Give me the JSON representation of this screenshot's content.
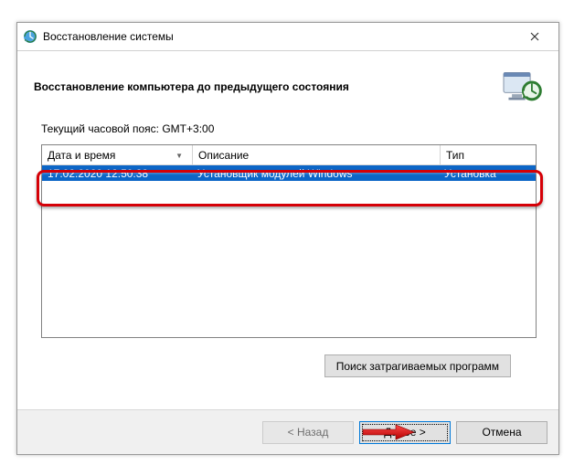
{
  "window": {
    "title": "Восстановление системы"
  },
  "header": {
    "title": "Восстановление компьютера до предыдущего состояния"
  },
  "tz_label": "Текущий часовой пояс: GMT+3:00",
  "table": {
    "columns": {
      "date": "Дата и время",
      "desc": "Описание",
      "type": "Тип"
    },
    "rows": [
      {
        "date": "17.02.2020 12:50:38",
        "desc": "Установщик модулей Windows",
        "type": "Установка",
        "selected": true
      }
    ]
  },
  "buttons": {
    "affected": "Поиск затрагиваемых программ",
    "back": "< Назад",
    "next": "Далее >",
    "cancel": "Отмена"
  }
}
